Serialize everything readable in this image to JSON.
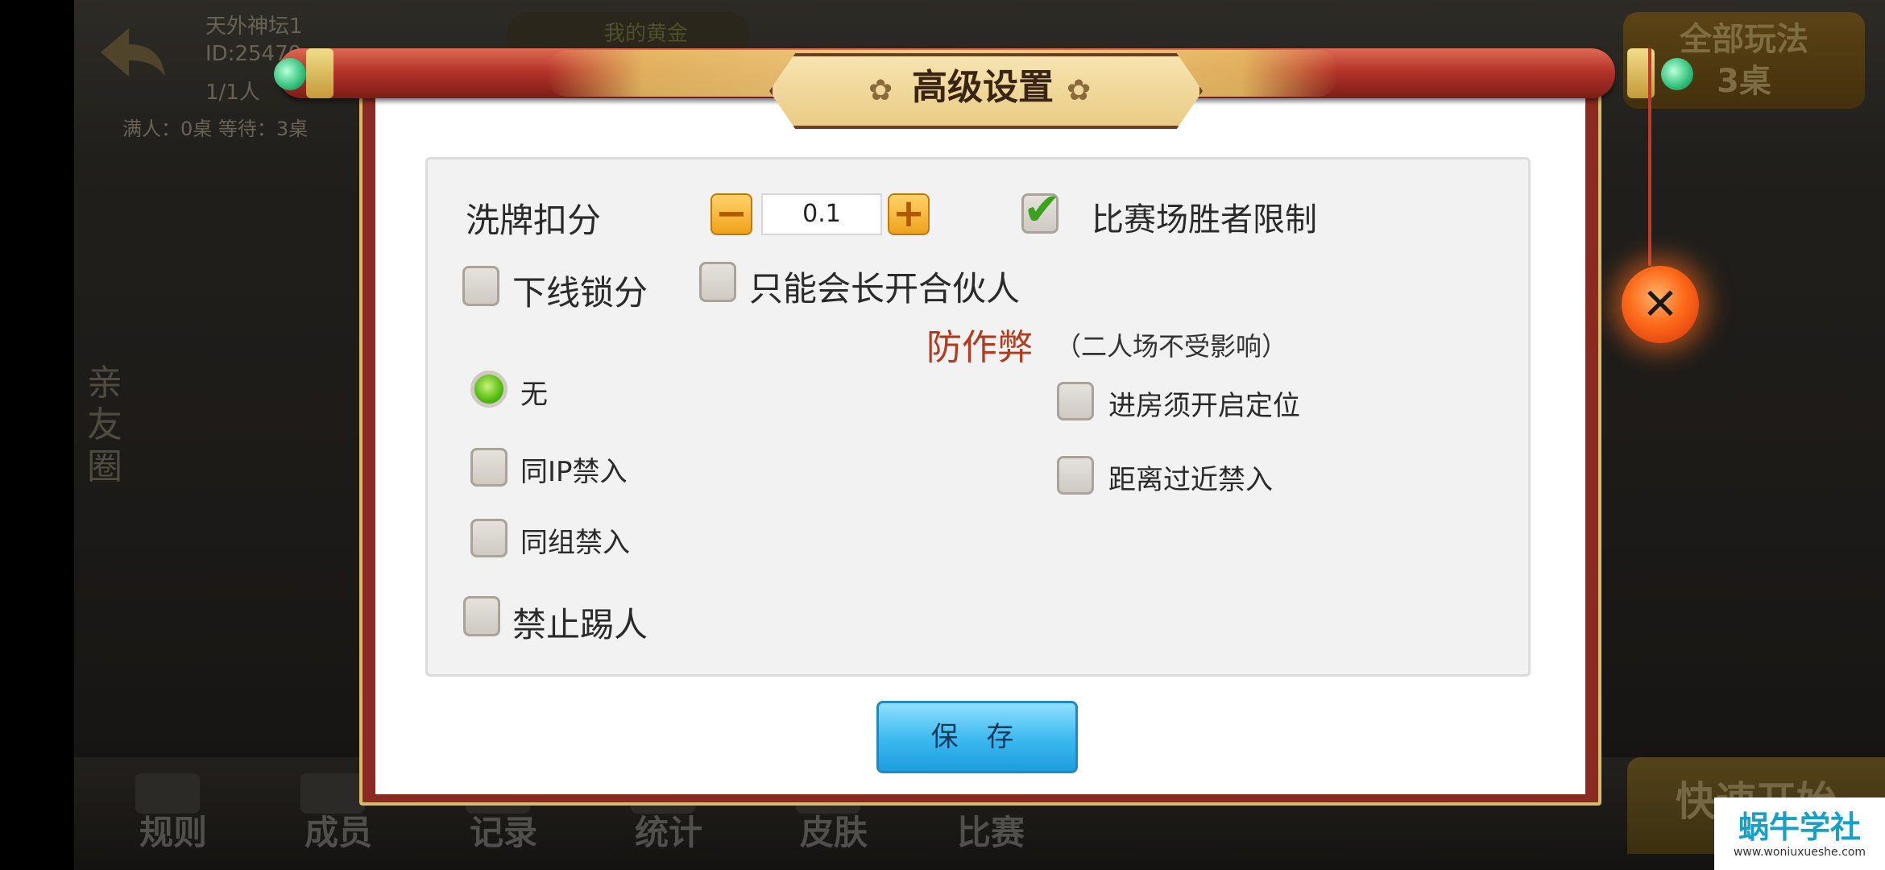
{
  "background": {
    "nickname": "天外神坛1",
    "id_text": "ID:25470",
    "player_count": "1/1人",
    "tables_status": "满人：0桌   等待：3桌",
    "gold_label": "我的黄金",
    "all_play_line1": "全部玩法",
    "all_play_line2": "3桌",
    "friend_circle": "亲友圈",
    "quick_start": "快速开始",
    "nav": [
      "规则",
      "成员",
      "记录",
      "统计",
      "皮肤",
      "比赛"
    ]
  },
  "dialog": {
    "title": "高级设置",
    "title_ornament": "✿",
    "shuffle_deduct_label": "洗牌扣分",
    "shuffle_deduct_value": "0.1",
    "minus": "−",
    "plus": "+",
    "winner_limit_label": "比赛场胜者限制",
    "winner_limit_checked": true,
    "offline_lock_label": "下线锁分",
    "only_president_label": "只能会长开合伙人",
    "anticheat_title": "防作弊",
    "anticheat_note": "（二人场不受影响）",
    "option_none": "无",
    "option_same_ip": "同IP禁入",
    "option_same_group": "同组禁入",
    "option_require_location": "进房须开启定位",
    "option_too_close": "距离过近禁入",
    "no_kick_label": "禁止踢人",
    "save_label": "保 存",
    "close_symbol": "✕"
  },
  "watermark": {
    "main": "蜗牛学社",
    "sub": "www.woniuxueshe.com"
  },
  "colors": {
    "frame_red": "#8b2a22",
    "title_gold": "#e9cc85",
    "anticheat_red": "#b33a1d",
    "save_blue": "#3ab8ef",
    "radio_green": "#5cbf16"
  }
}
